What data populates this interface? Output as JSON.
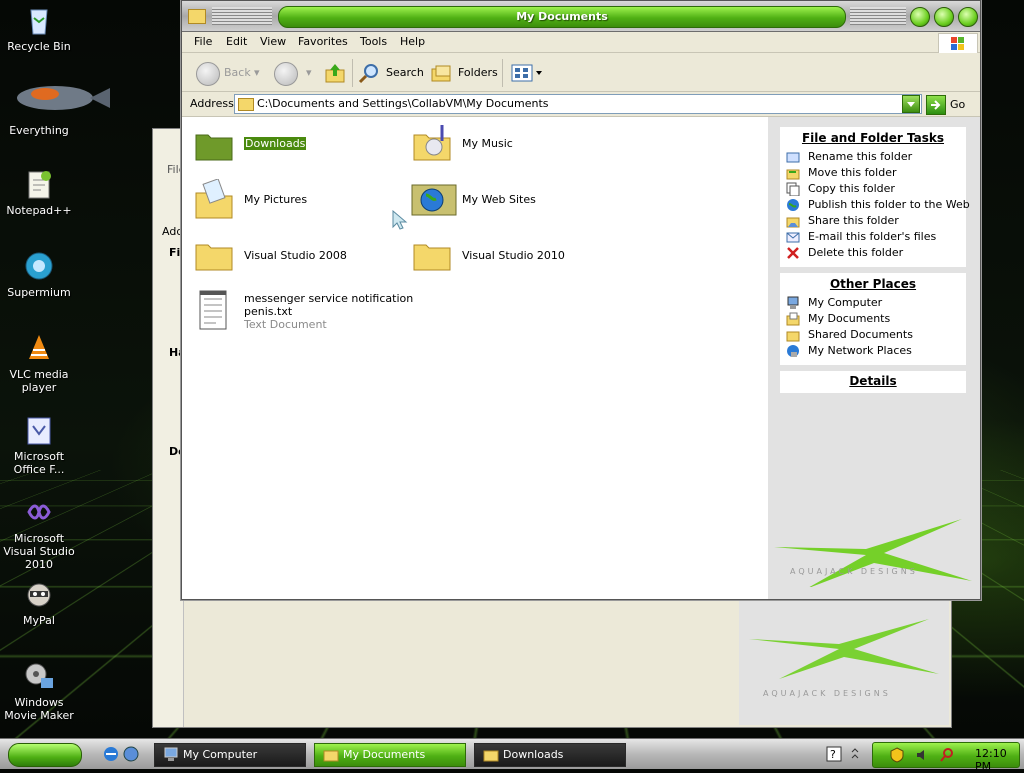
{
  "desktop": {
    "icons": [
      {
        "label": "Recycle Bin"
      },
      {
        "label": "Everything"
      },
      {
        "label": "Notepad++"
      },
      {
        "label": "Supermium"
      },
      {
        "label": "VLC media player"
      },
      {
        "label": "Microsoft Office F..."
      },
      {
        "label": "Microsoft Visual Studio 2010"
      },
      {
        "label": "MyPal"
      },
      {
        "label": "Windows Movie Maker"
      }
    ]
  },
  "background_window": {
    "fragments": [
      "File",
      "Add",
      "Fil",
      "Ha",
      "De"
    ],
    "logo_text": "AQUAJACK DESIGNS"
  },
  "window": {
    "title": "My Documents",
    "menu": [
      "File",
      "Edit",
      "View",
      "Favorites",
      "Tools",
      "Help"
    ],
    "toolbar": {
      "back": "Back",
      "search": "Search",
      "folders": "Folders"
    },
    "address": {
      "label": "Address",
      "path": "C:\\Documents and Settings\\CollabVM\\My Documents",
      "go": "Go"
    },
    "items": [
      {
        "name": "Downloads",
        "icon": "folder-icon",
        "selected": true
      },
      {
        "name": "My Music",
        "icon": "music-folder-icon"
      },
      {
        "name": "My Pictures",
        "icon": "pictures-folder-icon"
      },
      {
        "name": "My Web Sites",
        "icon": "web-sites-folder-icon"
      },
      {
        "name": "Visual Studio 2008",
        "icon": "folder-icon"
      },
      {
        "name": "Visual Studio 2010",
        "icon": "folder-icon"
      },
      {
        "name": "messenger service notification penis.txt",
        "line1": "messenger service notification",
        "line2": "penis.txt",
        "subtitle": "Text Document",
        "icon": "text-document-icon"
      }
    ],
    "taskpane": {
      "file_tasks": {
        "title": "File and Folder Tasks",
        "items": [
          "Rename this folder",
          "Move this folder",
          "Copy this folder",
          "Publish this folder to the Web",
          "Share this folder",
          "E-mail this folder's files",
          "Delete this folder"
        ]
      },
      "other_places": {
        "title": "Other Places",
        "items": [
          "My Computer",
          "My Documents",
          "Shared Documents",
          "My Network Places"
        ]
      },
      "details": {
        "title": "Details"
      },
      "logo_text": "AQUAJACK DESIGNS"
    }
  },
  "taskbar": {
    "buttons": [
      {
        "label": "My Computer",
        "active": false
      },
      {
        "label": "My Documents",
        "active": true
      },
      {
        "label": "Downloads",
        "active": false
      }
    ],
    "clock": "12:10 PM"
  },
  "colors": {
    "accent": "#4fb014",
    "selection": "#4a8a0e"
  }
}
